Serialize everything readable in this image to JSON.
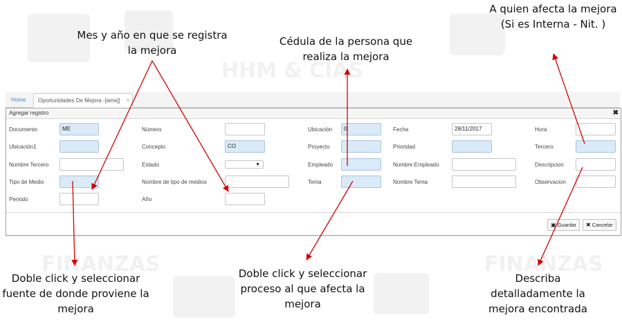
{
  "watermarks": [
    "HHM & CIAS",
    "FINANZAS",
    "FINANZAS"
  ],
  "tabs": {
    "home": "Home",
    "active": "Oportunidades De Mejora -[amej]",
    "close": "×"
  },
  "panel": {
    "title": "Agregar registro",
    "close": "✖",
    "fields": {
      "documento": {
        "label": "Documento",
        "value": "ME"
      },
      "numero": {
        "label": "Número",
        "value": ""
      },
      "ubicacion": {
        "label": "Ubicación",
        "value": "0"
      },
      "fecha": {
        "label": "Fecha",
        "value": "28/11/2017"
      },
      "hora": {
        "label": "Hora",
        "value": ""
      },
      "ubicacion1": {
        "label": "Ubicación1",
        "value": ""
      },
      "concepto": {
        "label": "Concepto",
        "value": "CO"
      },
      "proyecto": {
        "label": "Proyecto",
        "value": ""
      },
      "prioridad": {
        "label": "Prioridad",
        "value": ""
      },
      "tercero": {
        "label": "Tercero",
        "value": ""
      },
      "nombre_tercero": {
        "label": "Nombre Tercero",
        "value": ""
      },
      "estado": {
        "label": "Estado",
        "value": ""
      },
      "empleado": {
        "label": "Empleado",
        "value": ""
      },
      "nombre_empleado": {
        "label": "Nombre Empleado",
        "value": ""
      },
      "descripcion": {
        "label": "Descripcion",
        "value": ""
      },
      "tipo_medio": {
        "label": "Tipo de Medio",
        "value": ""
      },
      "nombre_tipo_medios": {
        "label": "Nombre de tipo de medios",
        "value": ""
      },
      "tema": {
        "label": "Tema",
        "value": ""
      },
      "nombre_tema": {
        "label": "Nombre Tema",
        "value": ""
      },
      "observacion": {
        "label": "Observacion",
        "value": ""
      },
      "periodo": {
        "label": "Periodo",
        "value": ""
      },
      "anio": {
        "label": "Año",
        "value": ""
      }
    },
    "buttons": {
      "save": "Guardar",
      "cancel": "Cancelar"
    }
  },
  "annotations": {
    "mes_anio": "Mes y año en que se registra la mejora",
    "cedula": "Cédula de la persona que realiza la mejora",
    "afecta": "A quien afecta la mejora (Si es Interna - Nit.                )",
    "doble_click_fuente": "Doble click y seleccionar fuente de donde proviene la mejora",
    "doble_click_proceso": "Doble click y seleccionar proceso al que afecta la mejora",
    "describa": "Describa detalladamente la mejora encontrada"
  },
  "colors": {
    "accent": "#3c8dbc",
    "field_highlight": "#dbeaf7",
    "arrow": "#d40000"
  }
}
